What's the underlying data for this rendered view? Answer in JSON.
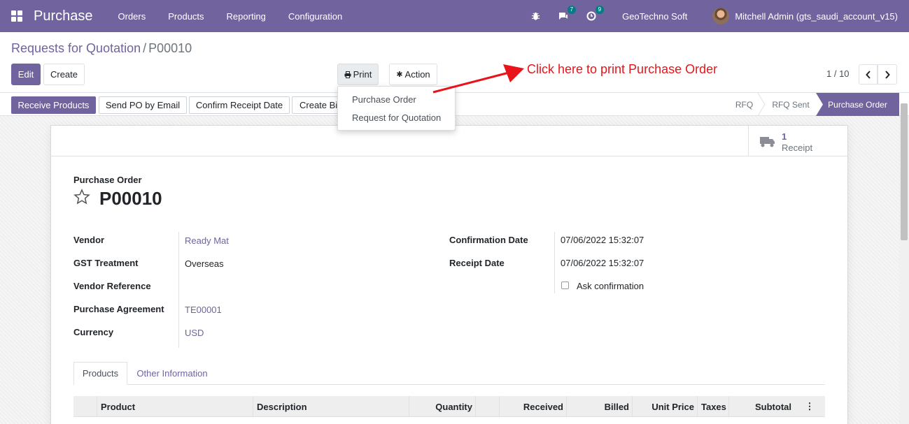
{
  "app": {
    "name": "Purchase",
    "menu": [
      "Orders",
      "Products",
      "Reporting",
      "Configuration"
    ],
    "messages_count": "7",
    "activities_count": "9",
    "company": "GeoTechno Soft",
    "user": "Mitchell Admin (gts_saudi_account_v15)"
  },
  "breadcrumb": {
    "parent": "Requests for Quotation",
    "separator": "/",
    "current": "P00010"
  },
  "toolbar": {
    "edit": "Edit",
    "create": "Create",
    "print": "Print",
    "action": "Action"
  },
  "print_menu": [
    "Purchase Order",
    "Request for Quotation"
  ],
  "annotation": "Click here to print Purchase Order",
  "pager": {
    "text": "1 / 10"
  },
  "statusbar": {
    "buttons": [
      "Receive Products",
      "Send PO by Email",
      "Confirm Receipt Date",
      "Create Bi"
    ],
    "stages": [
      "RFQ",
      "RFQ Sent",
      "Purchase Order"
    ],
    "active_stage": "Purchase Order"
  },
  "smart_button": {
    "count": "1",
    "label": "Receipt"
  },
  "form": {
    "doc_type": "Purchase Order",
    "name": "P00010",
    "left_fields": [
      {
        "label": "Vendor",
        "value": "Ready Mat"
      },
      {
        "label": "GST Treatment",
        "value": "Overseas"
      },
      {
        "label": "Vendor Reference",
        "value": ""
      },
      {
        "label": "Purchase Agreement",
        "value": "TE00001"
      },
      {
        "label": "Currency",
        "value": "USD"
      }
    ],
    "right_fields": [
      {
        "label": "Confirmation Date",
        "value": "07/06/2022 15:32:07"
      },
      {
        "label": "Receipt Date",
        "value": "07/06/2022 15:32:07"
      }
    ],
    "ask_confirmation": "Ask confirmation"
  },
  "tabs": [
    "Products",
    "Other Information"
  ],
  "table": {
    "columns": [
      "Product",
      "Description",
      "Quantity",
      "Received",
      "Billed",
      "Unit Price",
      "Taxes",
      "Subtotal"
    ]
  },
  "colors": {
    "brand": "#71639e",
    "annotation": "#e8141a",
    "badge": "#017e84"
  }
}
